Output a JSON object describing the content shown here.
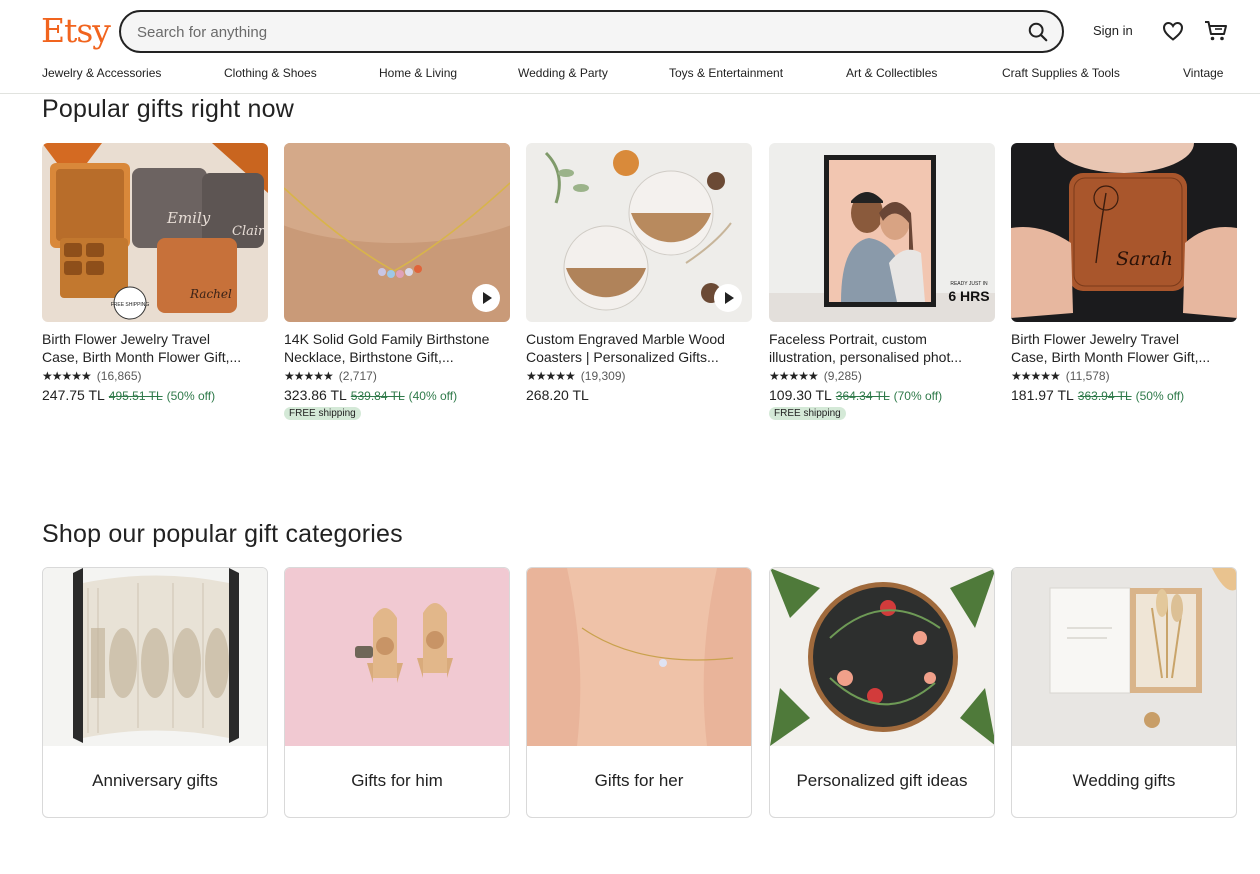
{
  "header": {
    "logo": "Etsy",
    "search_placeholder": "Search for anything",
    "sign_in": "Sign in"
  },
  "nav": [
    "Jewelry & Accessories",
    "Clothing & Shoes",
    "Home & Living",
    "Wedding & Party",
    "Toys & Entertainment",
    "Art & Collectibles",
    "Craft Supplies & Tools",
    "Vintage"
  ],
  "popular": {
    "title": "Popular gifts right now",
    "items": [
      {
        "title1": "Birth Flower Jewelry Travel",
        "title2": "Case, Birth Month Flower Gift,...",
        "stars": "★★★★★",
        "reviews": "(16,865)",
        "price": "247.75 TL",
        "original": "495.51 TL",
        "discount": "(50% off)",
        "shipping": ""
      },
      {
        "title1": "14K Solid Gold Family Birthstone",
        "title2": "Necklace, Birthstone Gift,...",
        "stars": "★★★★★",
        "reviews": "(2,717)",
        "price": "323.86 TL",
        "original": "539.84 TL",
        "discount": "(40% off)",
        "shipping": "FREE shipping"
      },
      {
        "title1": "Custom Engraved Marble Wood",
        "title2": "Coasters | Personalized Gifts...",
        "stars": "★★★★★",
        "reviews": "(19,309)",
        "price": "268.20 TL",
        "original": "",
        "discount": "",
        "shipping": ""
      },
      {
        "title1": "Faceless Portrait, custom",
        "title2": "illustration, personalised phot...",
        "stars": "★★★★★",
        "reviews": "(9,285)",
        "price": "109.30 TL",
        "original": "364.34 TL",
        "discount": "(70% off)",
        "shipping": "FREE shipping"
      },
      {
        "title1": "Birth Flower Jewelry Travel",
        "title2": "Case, Birth Month Flower Gift,...",
        "stars": "★★★★★",
        "reviews": "(11,578)",
        "price": "181.97 TL",
        "original": "363.94 TL",
        "discount": "(50% off)",
        "shipping": ""
      }
    ]
  },
  "image_text": {
    "emily": "Emily",
    "claire": "Claire",
    "rachel": "Rachel",
    "free_shipping_badge": "FREE SHIPPING",
    "ready_in": "READY JUST IN",
    "six_hrs": "6 HRS",
    "sarah": "Sarah"
  },
  "categories": {
    "title": "Shop our popular gift categories",
    "items": [
      "Anniversary gifts",
      "Gifts for him",
      "Gifts for her",
      "Personalized gift ideas",
      "Wedding gifts"
    ]
  },
  "colors": {
    "brand": "#f1641e",
    "sale_green": "#2f7a4a",
    "shipping_badge": "#d4e9d7"
  }
}
